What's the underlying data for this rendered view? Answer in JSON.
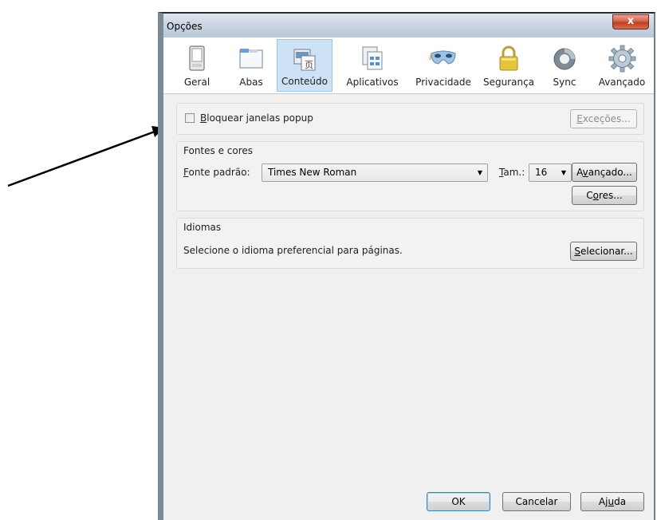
{
  "window": {
    "title": "Opções",
    "close_symbol": "x"
  },
  "toolbar": {
    "items": [
      {
        "label": "Geral",
        "icon": "general-icon",
        "active": false
      },
      {
        "label": "Abas",
        "icon": "tabs-icon",
        "active": false
      },
      {
        "label": "Conteúdo",
        "icon": "content-icon",
        "active": true
      },
      {
        "label": "Aplicativos",
        "icon": "applications-icon",
        "active": false
      },
      {
        "label": "Privacidade",
        "icon": "privacy-mask-icon",
        "active": false
      },
      {
        "label": "Segurança",
        "icon": "security-lock-icon",
        "active": false
      },
      {
        "label": "Sync",
        "icon": "sync-icon",
        "active": false
      },
      {
        "label": "Avançado",
        "icon": "advanced-gear-icon",
        "active": false
      }
    ]
  },
  "popup": {
    "checkbox_key": "B",
    "checkbox_rest": "loquear janelas popup",
    "checked": false,
    "exceptions_key": "E",
    "exceptions_rest": "xceções..."
  },
  "fonts": {
    "caption": "Fontes e cores",
    "default_font_key": "F",
    "default_font_rest": "onte padrão:",
    "default_font_value": "Times New Roman",
    "size_key": "T",
    "size_rest": "am.:",
    "size_value": "16",
    "advanced_pre": "A",
    "advanced_key": "v",
    "advanced_rest": "ançado...",
    "colors_pre": "C",
    "colors_key": "o",
    "colors_rest": "res..."
  },
  "languages": {
    "caption": "Idiomas",
    "description": "Selecione o idioma preferencial para páginas.",
    "select_key": "S",
    "select_rest": "elecionar..."
  },
  "footer": {
    "ok": "OK",
    "cancel": "Cancelar",
    "help_pre": "Aj",
    "help_key": "u",
    "help_rest": "da"
  },
  "colors": {
    "active_tab": "#cfe2f5",
    "close_button": "#c9452b"
  }
}
